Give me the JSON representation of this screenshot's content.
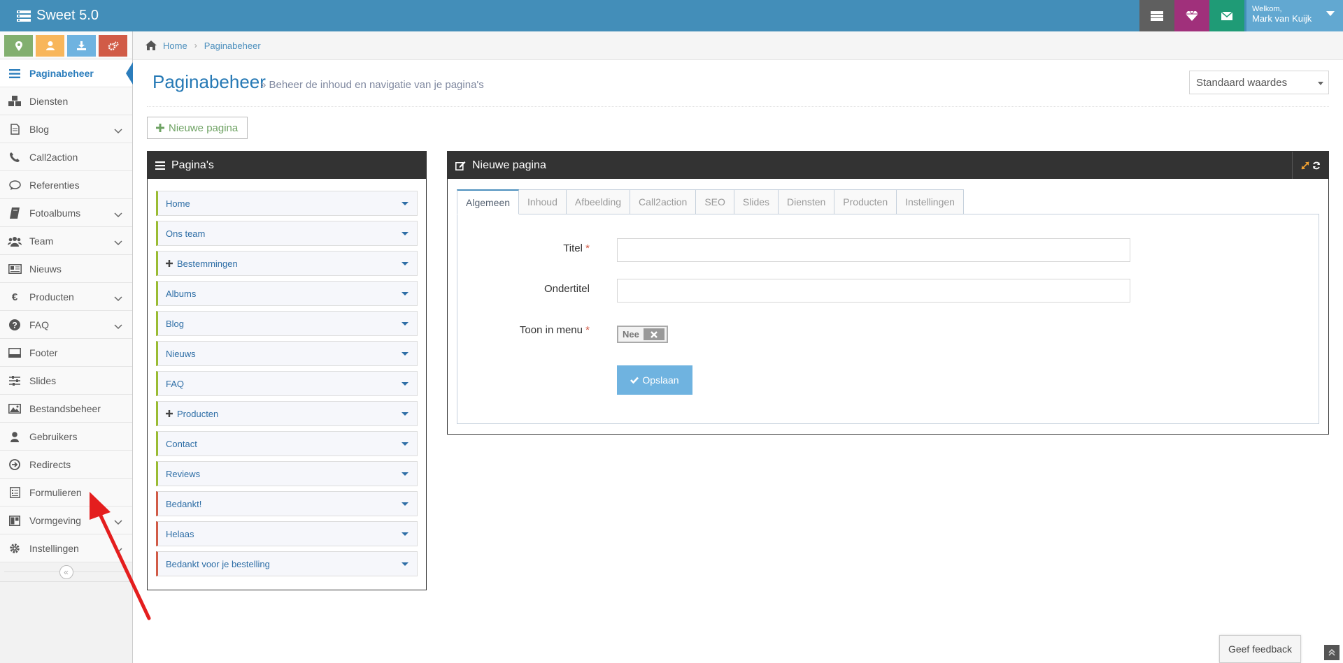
{
  "app": {
    "title": "Sweet 5.0"
  },
  "topbar": {
    "buttons": [
      {
        "icon": "server-icon",
        "color": "#5f5f5f"
      },
      {
        "icon": "diamond-icon",
        "color": "#a0307b"
      },
      {
        "icon": "envelope-icon",
        "color": "#1f9b76"
      }
    ],
    "user": {
      "greeting": "Welkom,",
      "name": "Mark van Kuijk"
    }
  },
  "sidebar": {
    "shortcuts": [
      {
        "icon": "map-marker-icon",
        "color": "#82af6f"
      },
      {
        "icon": "user-icon",
        "color": "#f8b65b"
      },
      {
        "icon": "download-icon",
        "color": "#6fb3e0"
      },
      {
        "icon": "cogs-icon",
        "color": "#d15b47"
      }
    ],
    "items": [
      {
        "label": "Paginabeheer",
        "icon": "list-icon",
        "active": true,
        "submenu": false
      },
      {
        "label": "Diensten",
        "icon": "cubes-icon",
        "submenu": false
      },
      {
        "label": "Blog",
        "icon": "document-icon",
        "submenu": true
      },
      {
        "label": "Call2action",
        "icon": "phone-icon",
        "submenu": false
      },
      {
        "label": "Referenties",
        "icon": "comment-icon",
        "submenu": false
      },
      {
        "label": "Fotoalbums",
        "icon": "book-icon",
        "submenu": true
      },
      {
        "label": "Team",
        "icon": "users-icon",
        "submenu": true
      },
      {
        "label": "Nieuws",
        "icon": "newspaper-icon",
        "submenu": false
      },
      {
        "label": "Producten",
        "icon": "euro-icon",
        "submenu": true
      },
      {
        "label": "FAQ",
        "icon": "question-icon",
        "submenu": true
      },
      {
        "label": "Footer",
        "icon": "footer-icon",
        "submenu": false
      },
      {
        "label": "Slides",
        "icon": "sliders-icon",
        "submenu": false
      },
      {
        "label": "Bestandsbeheer",
        "icon": "image-icon",
        "submenu": false
      },
      {
        "label": "Gebruikers",
        "icon": "user-icon",
        "submenu": false
      },
      {
        "label": "Redirects",
        "icon": "arrow-circle-icon",
        "submenu": false
      },
      {
        "label": "Formulieren",
        "icon": "form-icon",
        "submenu": false
      },
      {
        "label": "Vormgeving",
        "icon": "layout-icon",
        "submenu": true
      },
      {
        "label": "Instellingen",
        "icon": "gear-icon",
        "submenu": true
      }
    ],
    "collapse_glyph": "«"
  },
  "breadcrumb": {
    "home": "Home",
    "current": "Paginabeheer"
  },
  "header": {
    "title": "Paginabeheer",
    "subtitle": "» Beheer de inhoud en navigatie van je pagina's",
    "select_value": "Standaard waardes"
  },
  "new_page_button": "Nieuwe pagina",
  "pages_panel": {
    "title": "Pagina's",
    "items": [
      {
        "label": "Home",
        "expandable": false,
        "accent": "green"
      },
      {
        "label": "Ons team",
        "expandable": false,
        "accent": "green"
      },
      {
        "label": "Bestemmingen",
        "expandable": true,
        "accent": "green"
      },
      {
        "label": "Albums",
        "expandable": false,
        "accent": "green"
      },
      {
        "label": "Blog",
        "expandable": false,
        "accent": "green"
      },
      {
        "label": "Nieuws",
        "expandable": false,
        "accent": "green"
      },
      {
        "label": "FAQ",
        "expandable": false,
        "accent": "green"
      },
      {
        "label": "Producten",
        "expandable": true,
        "accent": "green"
      },
      {
        "label": "Contact",
        "expandable": false,
        "accent": "green"
      },
      {
        "label": "Reviews",
        "expandable": false,
        "accent": "green"
      },
      {
        "label": "Bedankt!",
        "expandable": false,
        "accent": "red"
      },
      {
        "label": "Helaas",
        "expandable": false,
        "accent": "red"
      },
      {
        "label": "Bedankt voor je bestelling",
        "expandable": false,
        "accent": "red"
      }
    ]
  },
  "edit_panel": {
    "title": "Nieuwe pagina",
    "tabs": [
      "Algemeen",
      "Inhoud",
      "Afbeelding",
      "Call2action",
      "SEO",
      "Slides",
      "Diensten",
      "Producten",
      "Instellingen"
    ],
    "active_tab": "Algemeen",
    "form": {
      "title_label": "Titel",
      "subtitle_label": "Ondertitel",
      "menu_label": "Toon in menu",
      "required_mark": "*",
      "title_value": "",
      "subtitle_value": "",
      "toggle_value": "Nee",
      "save_label": "Opslaan"
    }
  },
  "feedback_button": "Geef feedback",
  "colors": {
    "topbar": "#438eb9",
    "accent_blue": "#2679b5",
    "green_accent": "#9abc32",
    "red_accent": "#d15b47",
    "arrow": "#e41e1e"
  }
}
